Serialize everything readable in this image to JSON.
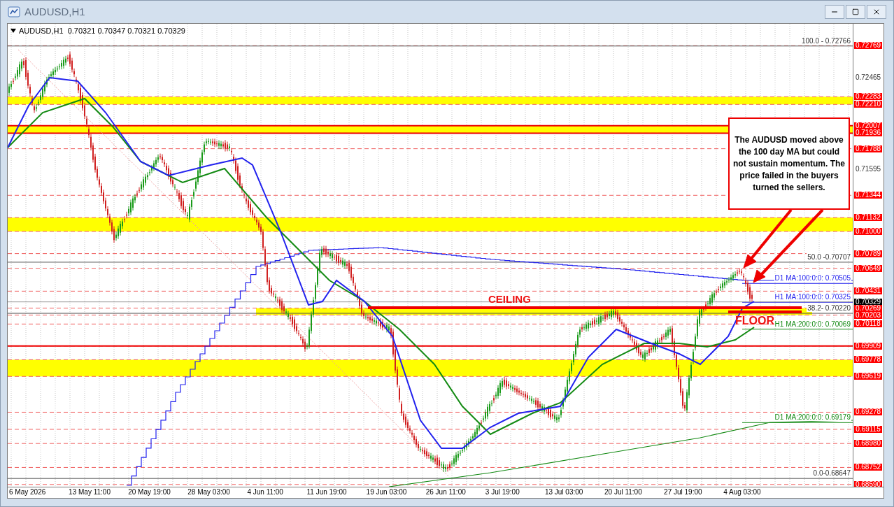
{
  "window": {
    "title": "AUDUSD,H1"
  },
  "chart": {
    "legend": "AUDUSD,H1  0.70321 0.70347 0.70321 0.70329",
    "price_labels": [
      {
        "text": "0.72769",
        "kind": "level"
      },
      {
        "text": "0.72465",
        "kind": "grid"
      },
      {
        "text": "0.72283",
        "kind": "level"
      },
      {
        "text": "0.72210",
        "kind": "level"
      },
      {
        "text": "0.72007",
        "kind": "level"
      },
      {
        "text": "0.71936",
        "kind": "level"
      },
      {
        "text": "0.71788",
        "kind": "level"
      },
      {
        "text": "0.71595",
        "kind": "grid"
      },
      {
        "text": "0.71344",
        "kind": "level"
      },
      {
        "text": "0.71132",
        "kind": "level"
      },
      {
        "text": "0.71000",
        "kind": "level"
      },
      {
        "text": "0.70789",
        "kind": "level"
      },
      {
        "text": "0.70649",
        "kind": "level"
      },
      {
        "text": "0.70431",
        "kind": "level"
      },
      {
        "text": "0.70329",
        "kind": "current"
      },
      {
        "text": "0.70269",
        "kind": "level"
      },
      {
        "text": "0.70203",
        "kind": "level"
      },
      {
        "text": "0.70118",
        "kind": "level"
      },
      {
        "text": "0.69909",
        "kind": "level"
      },
      {
        "text": "0.69778",
        "kind": "level"
      },
      {
        "text": "0.69619",
        "kind": "level"
      },
      {
        "text": "0.69278",
        "kind": "level"
      },
      {
        "text": "0.69115",
        "kind": "level"
      },
      {
        "text": "0.68980",
        "kind": "level"
      },
      {
        "text": "0.68752",
        "kind": "level"
      },
      {
        "text": "0.68590",
        "kind": "level"
      }
    ],
    "line_labels": [
      {
        "text": "100.0 - 0.72766",
        "kind": "fib"
      },
      {
        "text": "50.0 -0.70707",
        "kind": "fib"
      },
      {
        "text": "D1 MA:100:0:0: 0.70505",
        "kind": "ma_blue"
      },
      {
        "text": "H1 MA:100:0:0: 0.70325",
        "kind": "ma_blue"
      },
      {
        "text": "38.2- 0.70220",
        "kind": "fib"
      },
      {
        "text": "H1 MA:200:0:0: 0.70069",
        "kind": "ma_green"
      },
      {
        "text": "D1 MA:200:0:0: 0.69179",
        "kind": "ma_green"
      },
      {
        "text": "0.0-0.68647",
        "kind": "fib"
      }
    ],
    "time_labels": [
      "6 May 2026",
      "13 May 11:00",
      "20 May 19:00",
      "28 May 03:00",
      "4 Jun 11:00",
      "11 Jun 19:00",
      "19 Jun 03:00",
      "26 Jun 11:00",
      "3 Jul 19:00",
      "13 Jul 03:00",
      "20 Jul 11:00",
      "27 Jul 19:00",
      "4 Aug 03:00"
    ],
    "callouts": [
      {
        "text": "CEILING",
        "kind": "ceiling"
      },
      {
        "text": "FLOOR",
        "kind": "floor"
      }
    ],
    "note": "The AUDUSD moved above the 100 day MA but could not sustain momentum. The price failed in the buyers turned the sellers."
  }
}
